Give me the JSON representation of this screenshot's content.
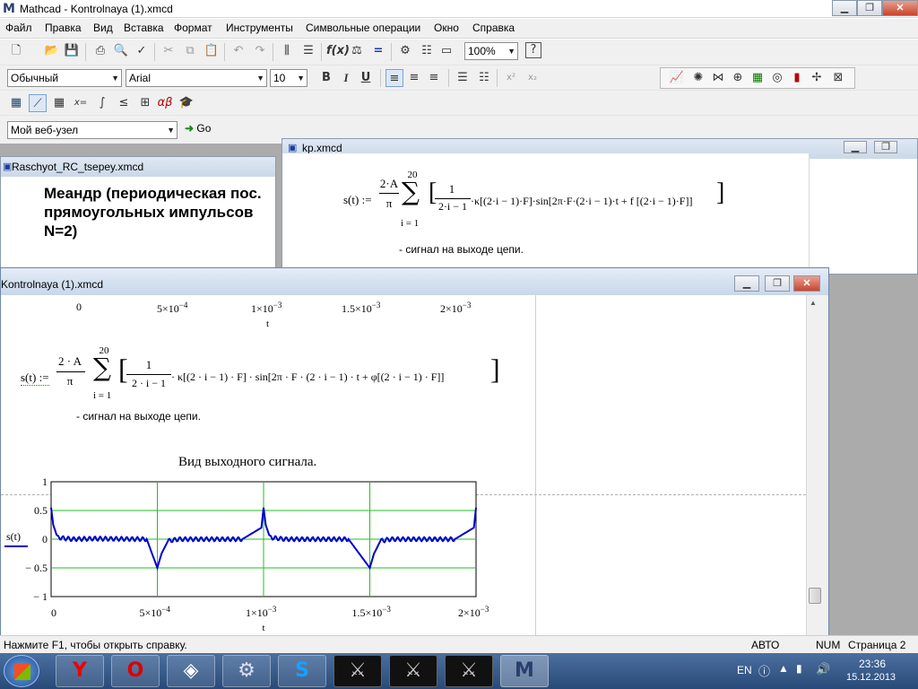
{
  "window": {
    "title": "Mathcad - Kontrolnaya (1).xmcd",
    "logo": "M"
  },
  "menu": [
    "Файл",
    "Правка",
    "Вид",
    "Вставка",
    "Формат",
    "Инструменты",
    "Символьные операции",
    "Окно",
    "Справка"
  ],
  "toolbar": {
    "zoom": "100%",
    "style": "Обычный",
    "font": "Arial",
    "size": "10",
    "bold": "B",
    "italic": "I",
    "underline": "U",
    "url": "Мой веб-узел",
    "go": "Go"
  },
  "docs": {
    "raschyot": {
      "title": "Raschyot_RC_tsepey.xmcd",
      "heading_lines": [
        "Меандр (периодическая пос.",
        "прямоугольных импульсов",
        "N=2)"
      ]
    },
    "kp": {
      "title": "kp.xmcd",
      "formula_lhs": "s(t) :=",
      "frac_num": "2·A",
      "frac_den": "π",
      "sum_top": "20",
      "sum_bottom": "i = 1",
      "inner_num": "1",
      "inner_den": "2·i − 1",
      "body": "·κ[(2·i − 1)·F]·sin[2π·F·(2·i − 1)·t + f [(2·i − 1)·F]]",
      "caption": "- сигнал на выходе цепи."
    },
    "kontrolnaya": {
      "title": "Kontrolnaya (1).xmcd",
      "top_ticks": [
        "0",
        "5×10",
        "1×10",
        "1.5×10",
        "2×10"
      ],
      "top_tick_exps": [
        "",
        "−4",
        "−3",
        "−3",
        "−3"
      ],
      "top_axis_label": "t",
      "formula_lhs": "s(t) :=",
      "frac_num": "2 · A",
      "frac_den": "π",
      "sum_top": "20",
      "sum_bottom": "i = 1",
      "inner_num": "1",
      "inner_den": "2 · i − 1",
      "body": "· κ[(2 · i − 1) · F] · sin[2π · F · (2 · i − 1) · t + φ[(2 · i − 1) · F]]",
      "caption": "- сигнал на выходе цепи.",
      "chart_title": "Вид выходного сигнала."
    }
  },
  "chart_data": {
    "type": "line",
    "title": "Вид выходного сигнала.",
    "xlabel": "t",
    "ylabel": "s(t)",
    "xlim": [
      0,
      0.002
    ],
    "ylim": [
      -1,
      1
    ],
    "x_ticks": [
      "0",
      "5×10",
      "1×10",
      "1.5×10",
      "2×10"
    ],
    "x_tick_exps": [
      "",
      "−4",
      "−3",
      "−3",
      "−3"
    ],
    "y_ticks": [
      "1",
      "0.5",
      "0",
      "− 0.5",
      "− 1"
    ],
    "grid": true,
    "series": [
      {
        "color": "#0000cc",
        "x": [
          0,
          1e-05,
          3e-05,
          0.0001,
          0.0002,
          0.00045,
          0.0005,
          0.00052,
          0.00055,
          0.0006,
          0.0009,
          0.00099,
          0.001,
          0.00101,
          0.00103,
          0.0011,
          0.0014,
          0.0015,
          0.00152,
          0.00155,
          0.0016,
          0.0019,
          0.00199,
          0.002
        ],
        "y": [
          0.55,
          0.25,
          0.03,
          0.0,
          0.01,
          0.0,
          -0.5,
          -0.25,
          -0.03,
          0.0,
          0.0,
          0.2,
          0.55,
          0.25,
          0.03,
          0.0,
          0.0,
          -0.5,
          -0.25,
          -0.03,
          0.0,
          0.0,
          0.2,
          0.55
        ]
      }
    ]
  },
  "status": {
    "help": "Нажмите F1, чтобы открыть справку.",
    "auto": "АВТО",
    "num": "NUM",
    "page": "Страница 2"
  },
  "taskbar": {
    "lang": "EN",
    "time": "23:36",
    "date": "15.12.2013"
  }
}
